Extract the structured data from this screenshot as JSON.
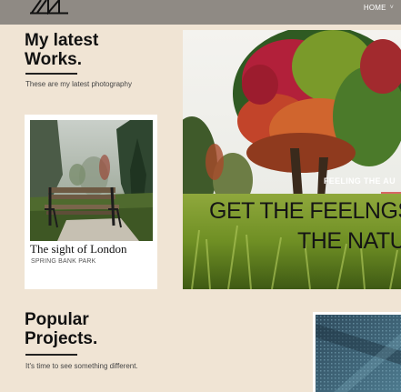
{
  "header": {
    "nav_home": "HOME",
    "nav_chevron": "˅"
  },
  "latest": {
    "title_line1": "My latest",
    "title_line2": "Works.",
    "subtitle": "These are my latest photography"
  },
  "card": {
    "title": "The sight of London",
    "subtitle": "SPRING BANK PARK"
  },
  "hero": {
    "kicker": "FEELING THE AU",
    "line1": "GET THE FEELNGS O",
    "line2": "THE NATU"
  },
  "popular": {
    "title_line1": "Popular",
    "title_line2": "Projects.",
    "subtitle": "It's time to see something different."
  },
  "colors": {
    "page_bg": "#f0e4d4",
    "topbar_bg": "#8f8a84",
    "accent_line": "#d23a3a"
  }
}
